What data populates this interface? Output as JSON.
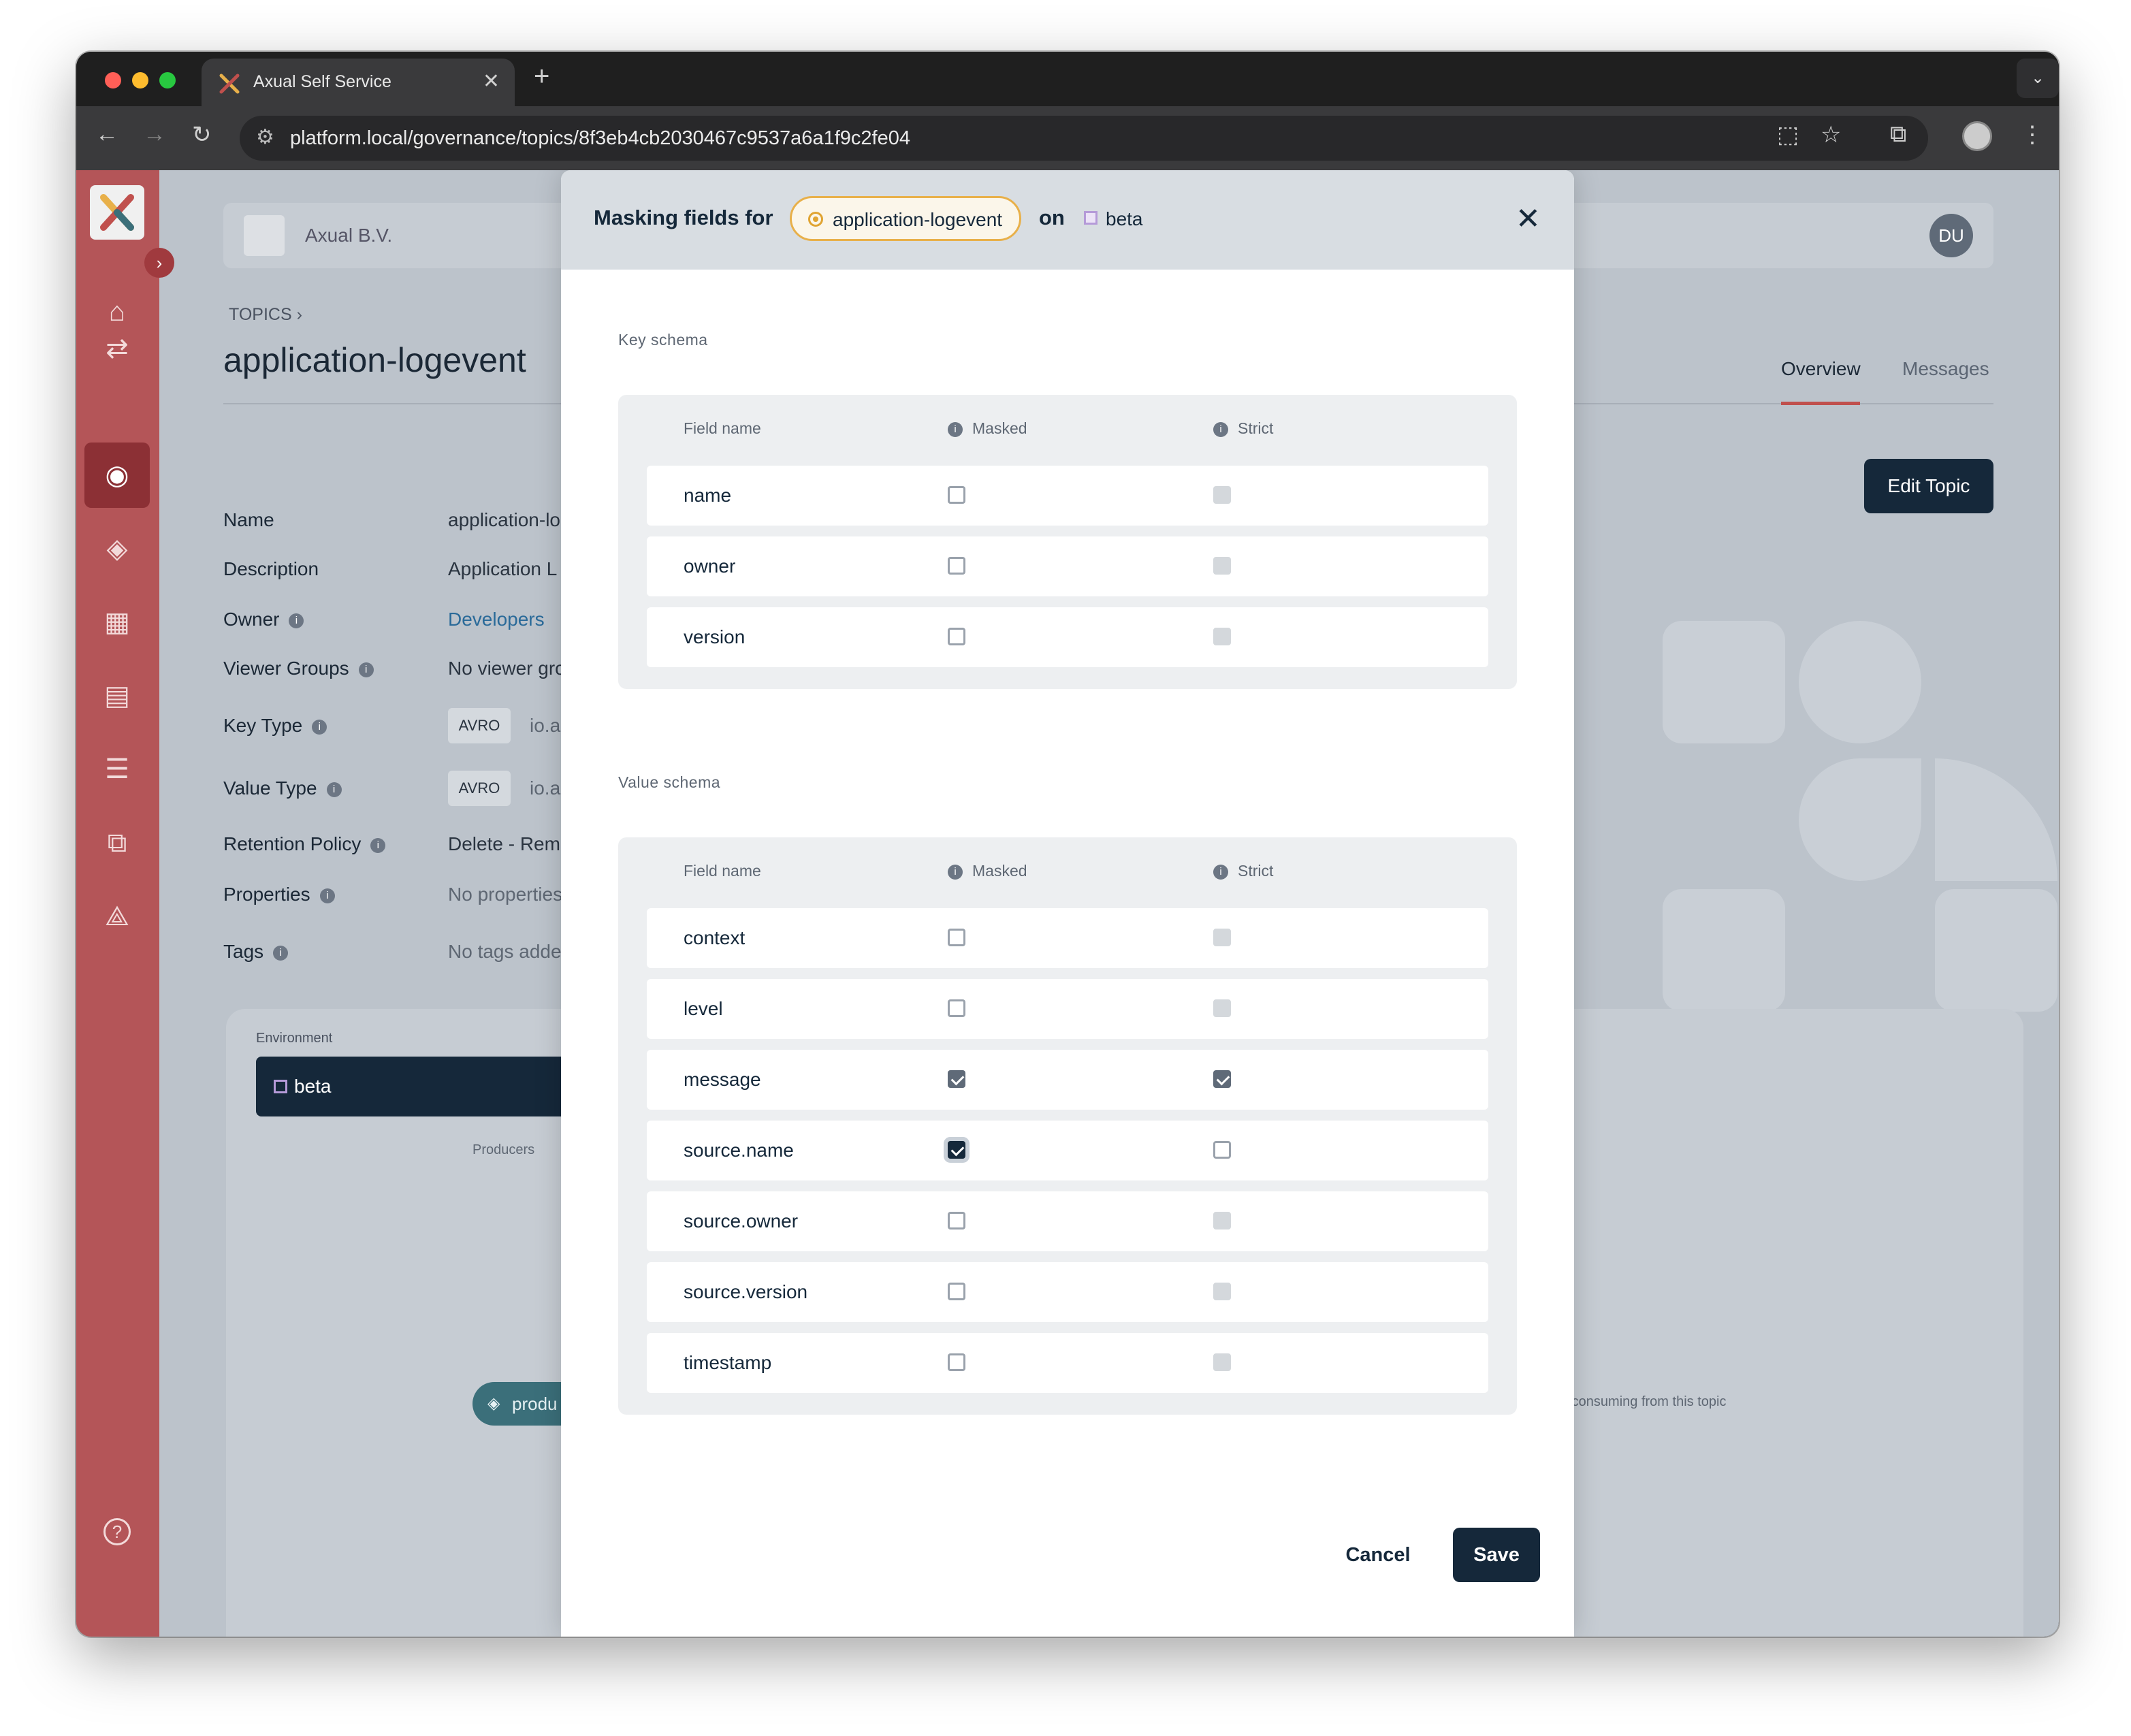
{
  "browser": {
    "tab_title": "Axual Self Service",
    "tab_close": "✕",
    "new_tab": "+",
    "tab_menu": "⌄",
    "url": "platform.local/governance/topics/8f3eb4cb2030467c9537a6a1f9c2fe04",
    "colors": {
      "close": "#ff5f57",
      "minimize": "#febc2e",
      "maximize": "#28c840"
    }
  },
  "sidebar": {
    "toggle": "›",
    "items": [
      {
        "icon": "home-icon",
        "glyph": "⌂"
      },
      {
        "icon": "streams-icon",
        "glyph": "⇄"
      },
      {
        "icon": "topics-icon",
        "glyph": "◉"
      },
      {
        "icon": "applications-icon",
        "glyph": "◈"
      },
      {
        "icon": "dashboard-icon",
        "glyph": "▦"
      },
      {
        "icon": "clipboard-icon",
        "glyph": "▤"
      },
      {
        "icon": "settings-sliders-icon",
        "glyph": "☰"
      },
      {
        "icon": "copy-icon",
        "glyph": "⧉"
      },
      {
        "icon": "network-icon",
        "glyph": "⟁"
      }
    ],
    "help_glyph": "?"
  },
  "header": {
    "org_name": "Axual B.V.",
    "avatar": "DU"
  },
  "topic": {
    "breadcrumb": "TOPICS",
    "breadcrumb_sep": "›",
    "title": "application-logevent",
    "tabs": [
      "Overview",
      "Messages"
    ],
    "edit_button": "Edit Topic",
    "properties": [
      {
        "label": "Name",
        "value": "application-lo"
      },
      {
        "label": "Description",
        "value": "Application L"
      },
      {
        "label": "Owner",
        "value": "Developers"
      },
      {
        "label": "Viewer Groups",
        "value": "No viewer gro"
      },
      {
        "label": "Key Type",
        "badge": "AVRO",
        "value": "io.a"
      },
      {
        "label": "Value Type",
        "badge": "AVRO",
        "value": "io.a"
      },
      {
        "label": "Retention Policy",
        "value": "Delete - Remo"
      },
      {
        "label": "Properties",
        "value": "No properties"
      },
      {
        "label": "Tags",
        "value": "No tags adde"
      }
    ],
    "info_glyph": "i"
  },
  "environment": {
    "label": "Environment",
    "selected": "beta",
    "producers_label": "Producers",
    "producer_pill": "produ",
    "consuming_note": "n is consuming from this topic"
  },
  "modal": {
    "title": "Masking fields for",
    "topic_chip": "application-logevent",
    "on_text": "on",
    "env_chip": "beta",
    "close_glyph": "✕",
    "key_schema": {
      "label": "Key schema",
      "headers": {
        "field": "Field name",
        "masked": "Masked",
        "strict": "Strict"
      },
      "rows": [
        {
          "name": "name",
          "masked": false,
          "strict": false,
          "strict_disabled": true
        },
        {
          "name": "owner",
          "masked": false,
          "strict": false,
          "strict_disabled": true
        },
        {
          "name": "version",
          "masked": false,
          "strict": false,
          "strict_disabled": true
        }
      ]
    },
    "value_schema": {
      "label": "Value schema",
      "headers": {
        "field": "Field name",
        "masked": "Masked",
        "strict": "Strict"
      },
      "rows": [
        {
          "name": "context",
          "masked": false,
          "strict": false,
          "strict_disabled": true
        },
        {
          "name": "level",
          "masked": false,
          "strict": false,
          "strict_disabled": true
        },
        {
          "name": "message",
          "masked": true,
          "strict": true,
          "strict_disabled": false
        },
        {
          "name": "source.name",
          "masked": true,
          "strict": false,
          "strict_disabled": false,
          "focused": true
        },
        {
          "name": "source.owner",
          "masked": false,
          "strict": false,
          "strict_disabled": true
        },
        {
          "name": "source.version",
          "masked": false,
          "strict": false,
          "strict_disabled": true
        },
        {
          "name": "timestamp",
          "masked": false,
          "strict": false,
          "strict_disabled": true
        }
      ]
    },
    "cancel": "Cancel",
    "save": "Save"
  }
}
